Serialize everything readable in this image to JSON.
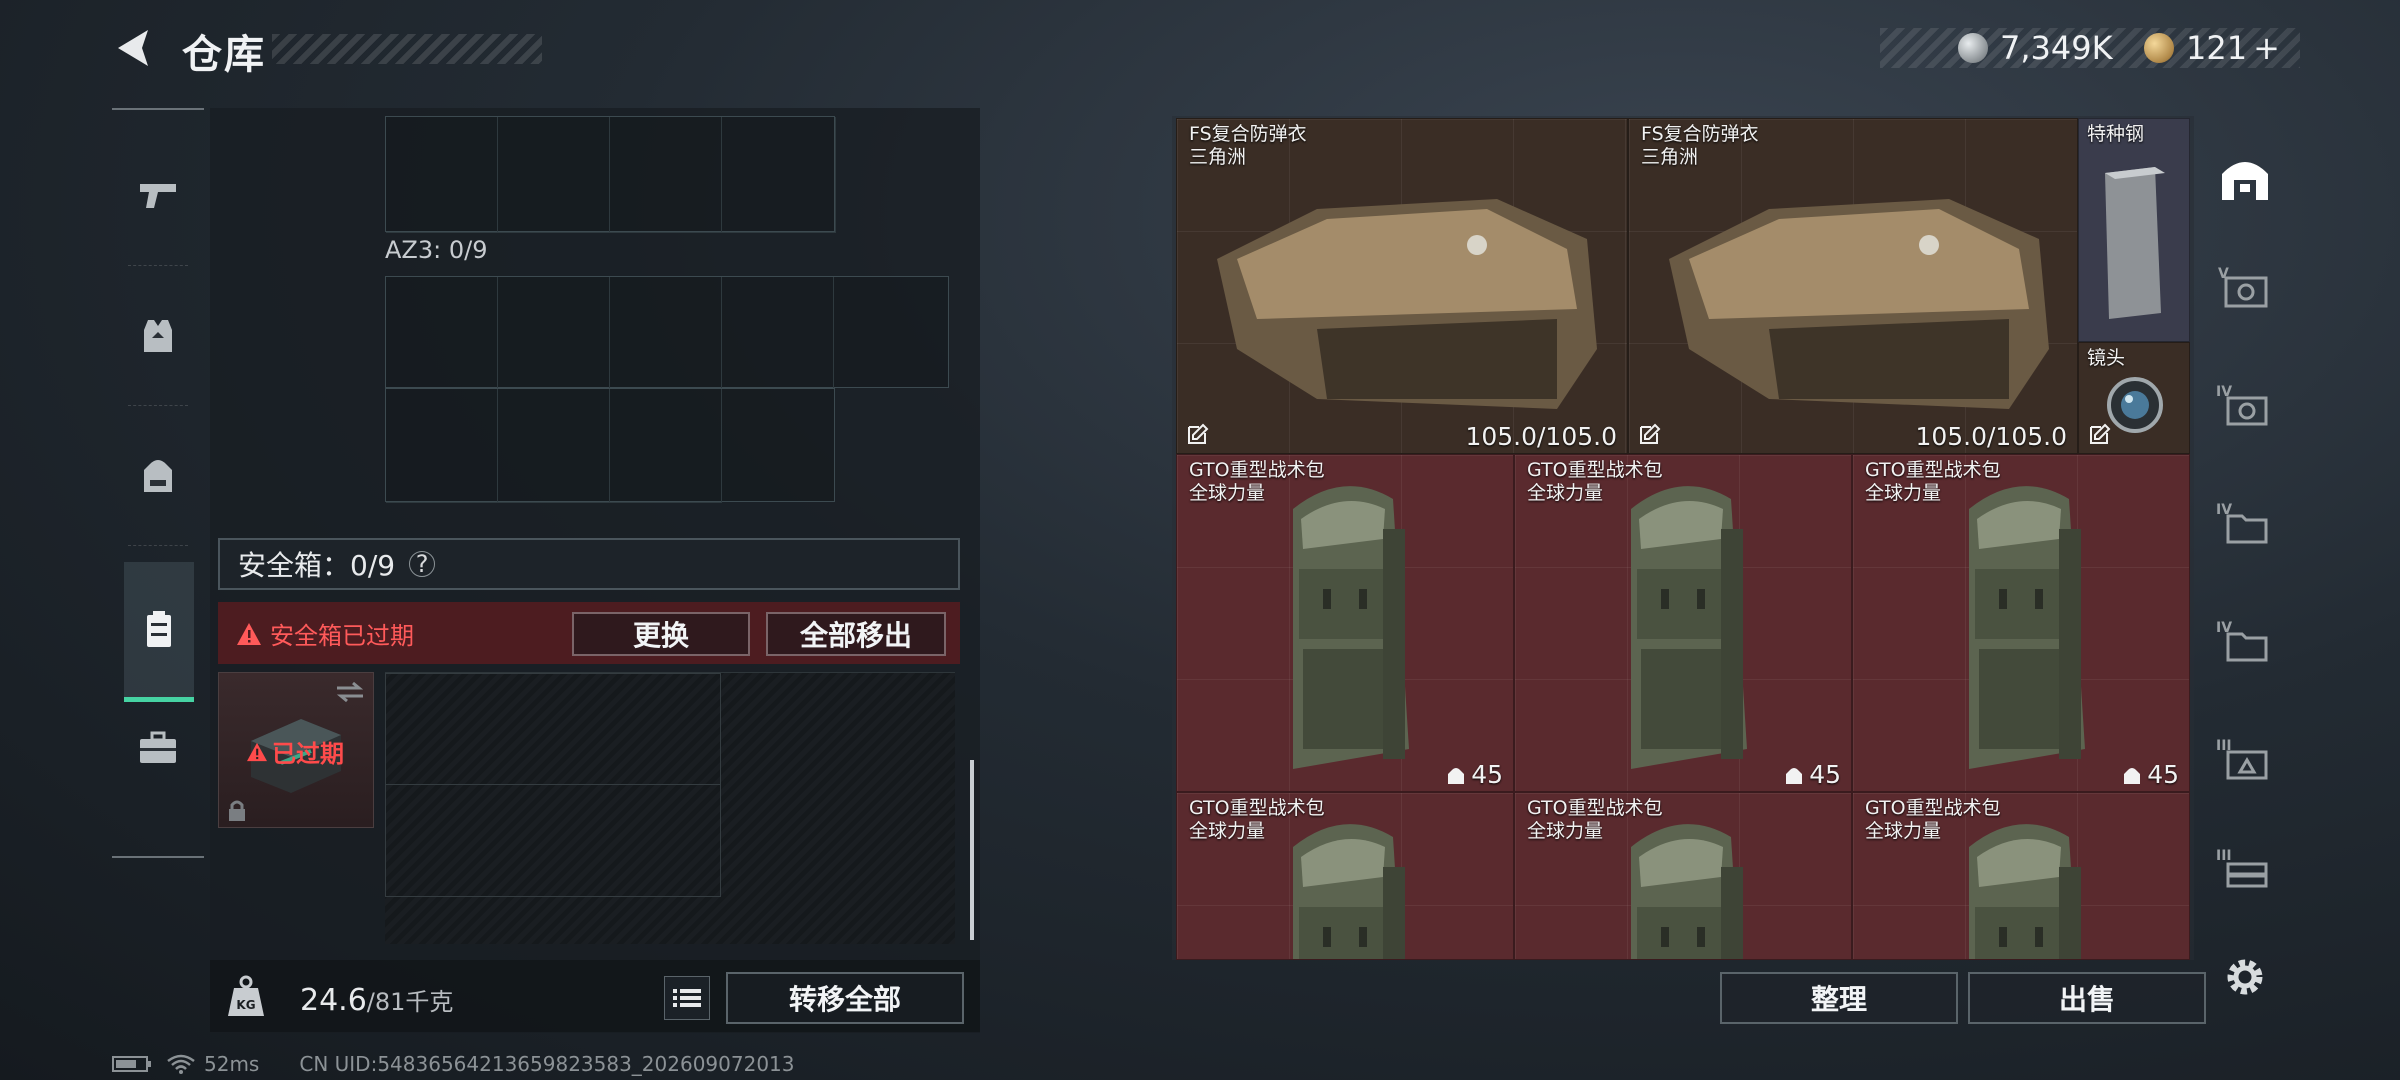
{
  "header": {
    "title": "仓库",
    "currency_silver": "7,349K",
    "currency_gold": "121",
    "currency_add": "+"
  },
  "left_nav": [
    {
      "icon": "pistol-icon"
    },
    {
      "icon": "armor-vest-icon"
    },
    {
      "icon": "backpack-icon"
    },
    {
      "icon": "safe-box-icon",
      "active": true
    },
    {
      "icon": "briefcase-icon"
    }
  ],
  "left_panel": {
    "az3_label": "AZ3: 0/9",
    "safe_box_label": "安全箱：0/9",
    "help": "?",
    "expired_warning": "安全箱已过期",
    "replace_label": "更换",
    "move_all_out_label": "全部移出",
    "safe_slot_status": "已过期"
  },
  "bottom_bar": {
    "weight_icon_label": "KG",
    "weight_current": "24.6",
    "weight_cap": "/81千克",
    "transfer_all_label": "转移全部"
  },
  "status": {
    "ping": "52ms",
    "uid": "CN UID:548365642136598235​83_202609072013"
  },
  "items": [
    {
      "name": "FS复合防弹衣",
      "sub": "三角洲",
      "value": "105.0/105.0",
      "kind": "armor"
    },
    {
      "name": "FS复合防弹衣",
      "sub": "三角洲",
      "value": "105.0/105.0",
      "kind": "armor"
    },
    {
      "name": "特种钢",
      "sub": "",
      "value": "",
      "kind": "steel"
    },
    {
      "name": "镜头",
      "sub": "",
      "value": "",
      "kind": "lens"
    },
    {
      "name": "GTO重型战术包",
      "sub": "全球力量",
      "value": "45",
      "kind": "bag"
    },
    {
      "name": "GTO重型战术包",
      "sub": "全球力量",
      "value": "45",
      "kind": "bag"
    },
    {
      "name": "GTO重型战术包",
      "sub": "全球力量",
      "value": "45",
      "kind": "bag"
    },
    {
      "name": "GTO重型战术包",
      "sub": "全球力量",
      "value": "",
      "kind": "bag"
    },
    {
      "name": "GTO重型战术包",
      "sub": "全球力量",
      "value": "",
      "kind": "bag"
    },
    {
      "name": "GTO重型战术包",
      "sub": "全球力量",
      "value": "",
      "kind": "bag"
    }
  ],
  "right_nav": [
    {
      "icon": "home-storage-icon",
      "active": true
    },
    {
      "icon": "storage-v-icon",
      "tier": "V"
    },
    {
      "icon": "storage-iv-icon",
      "tier": "IV"
    },
    {
      "icon": "storage-iv-b-icon",
      "tier": "IV"
    },
    {
      "icon": "storage-iv-c-icon",
      "tier": "IV"
    },
    {
      "icon": "storage-iii-icon",
      "tier": "III"
    },
    {
      "icon": "storage-iii-b-icon",
      "tier": "III"
    }
  ],
  "actions": {
    "sort_label": "整理",
    "sell_label": "出售"
  }
}
